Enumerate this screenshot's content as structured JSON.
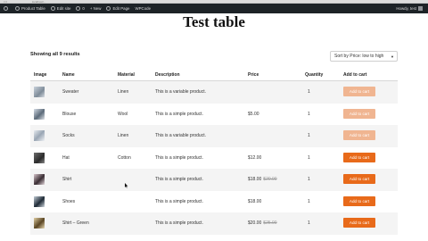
{
  "browser": {
    "url": "localhost/..."
  },
  "admin_bar": {
    "items": [
      {
        "label": "Product Table",
        "icon": "house-icon"
      },
      {
        "label": "Edit site",
        "icon": "pencil-icon"
      },
      {
        "label": "0",
        "icon": "comment-icon"
      },
      {
        "label": "+ New",
        "icon": "plus-icon"
      },
      {
        "label": "Edit Page",
        "icon": "pencil-icon"
      },
      {
        "label": "WPCode",
        "icon": "code-icon"
      }
    ],
    "greeting": "Howdy, test"
  },
  "page": {
    "title": "Test table"
  },
  "results_text": "Showing all 9 results",
  "sort": {
    "selected": "Sort by Price: low to high"
  },
  "table": {
    "headers": [
      "Image",
      "Name",
      "Material",
      "Description",
      "Price",
      "Quantity",
      "Add to cart"
    ],
    "rows": [
      {
        "name": "Sweater",
        "material": "Linen",
        "description": "This is a variable product.",
        "price": "",
        "old_price": "",
        "quantity": "1",
        "button": "Add to cart",
        "disabled": true
      },
      {
        "name": "Blouse",
        "material": "Wool",
        "description": "This is a simple product.",
        "price": "$5.00",
        "old_price": "",
        "quantity": "1",
        "button": "Add to cart",
        "disabled": true
      },
      {
        "name": "Socks",
        "material": "Linen",
        "description": "This is a variable product.",
        "price": "",
        "old_price": "",
        "quantity": "1",
        "button": "Add to cart",
        "disabled": true
      },
      {
        "name": "Hat",
        "material": "Cotton",
        "description": "This is a simple product.",
        "price": "$12.00",
        "old_price": "",
        "quantity": "1",
        "button": "Add to cart",
        "disabled": false
      },
      {
        "name": "Shirt",
        "material": "",
        "description": "This is a simple product.",
        "price": "$18.00",
        "old_price": "$20.00",
        "quantity": "1",
        "button": "Add to cart",
        "disabled": false
      },
      {
        "name": "Shoes",
        "material": "",
        "description": "This is a simple product.",
        "price": "$18.00",
        "old_price": "",
        "quantity": "1",
        "button": "Add to cart",
        "disabled": false
      },
      {
        "name": "Shirt – Green",
        "material": "",
        "description": "This is a simple product.",
        "price": "$20.00",
        "old_price": "$25.00",
        "quantity": "1",
        "button": "Add to cart",
        "disabled": false
      }
    ]
  },
  "colors": {
    "accent": "#e86a1a",
    "accent_disabled": "#f0b591",
    "admin_bar": "#1d2327"
  }
}
